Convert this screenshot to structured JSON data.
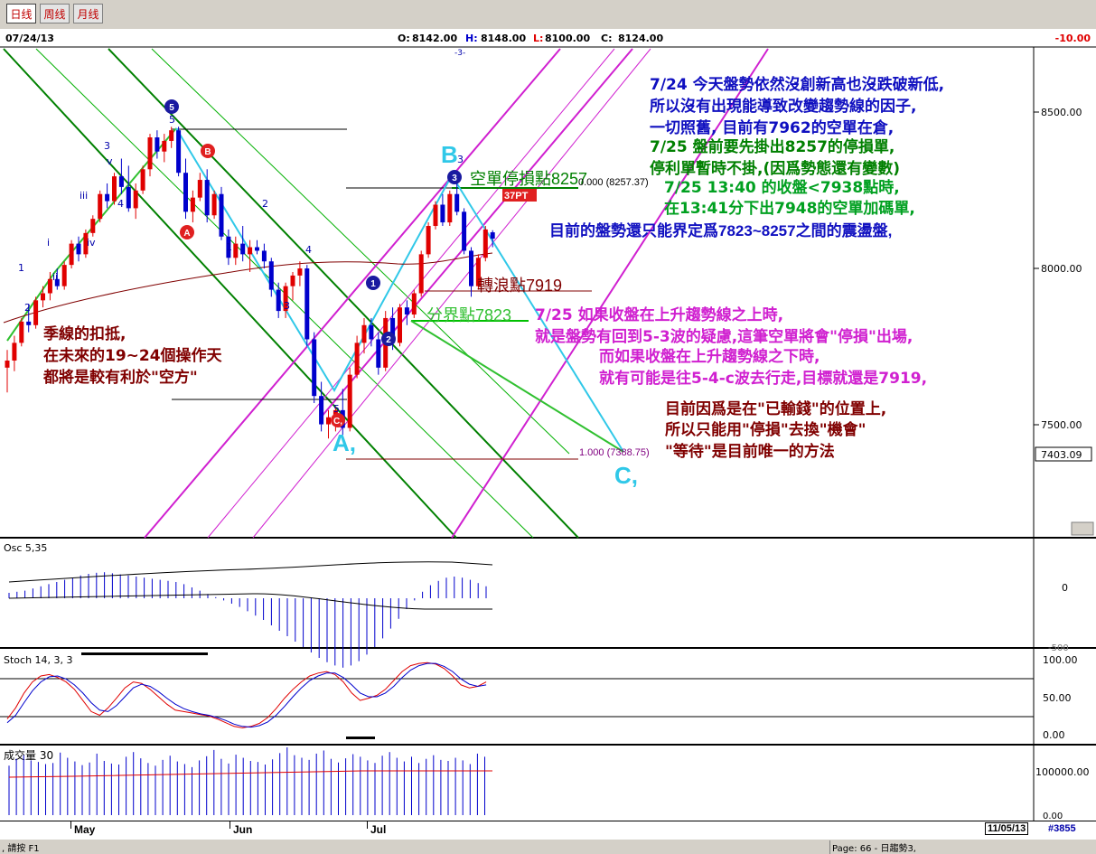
{
  "toolbar": {
    "buttons": [
      "日线",
      "周线",
      "月线"
    ]
  },
  "header": {
    "date": "07/24/13",
    "open_label": "O:",
    "open": "8142.00",
    "high_label": "H:",
    "high": "8148.00",
    "low_label": "L:",
    "low": "8100.00",
    "close_label": "C:",
    "close": "8124.00",
    "change": "-10.00"
  },
  "colors": {
    "up": "#e00000",
    "down": "#0000cc",
    "green_channel": "#008000",
    "magenta_channel": "#d020d0",
    "cyan_wave": "#30c8e8",
    "note_blue": "#1010c0",
    "note_green": "#008000",
    "note_magenta": "#d020d0",
    "note_maroon": "#800000"
  },
  "chart_data": [
    {
      "type": "candlestick",
      "title": "",
      "ylim": [
        7280,
        8660
      ],
      "y_ticks": [
        "8500.00",
        "8000.00",
        "7500.00"
      ],
      "last_price_label": "7403.09",
      "x_month_labels": [
        "May",
        "Jun",
        "Jul"
      ],
      "ohlc": [
        [
          7760,
          7810,
          7690,
          7780
        ],
        [
          7780,
          7850,
          7750,
          7830
        ],
        [
          7830,
          7900,
          7820,
          7890
        ],
        [
          7890,
          7940,
          7860,
          7880
        ],
        [
          7880,
          7960,
          7870,
          7950
        ],
        [
          7950,
          7990,
          7930,
          7970
        ],
        [
          7970,
          8030,
          7950,
          8010
        ],
        [
          8010,
          8040,
          7980,
          7990
        ],
        [
          7990,
          8060,
          7980,
          8050
        ],
        [
          8050,
          8120,
          8040,
          8110
        ],
        [
          8110,
          8130,
          8060,
          8080
        ],
        [
          8080,
          8150,
          8070,
          8140
        ],
        [
          8140,
          8190,
          8130,
          8180
        ],
        [
          8180,
          8260,
          8170,
          8250
        ],
        [
          8250,
          8280,
          8210,
          8230
        ],
        [
          8230,
          8310,
          8220,
          8300
        ],
        [
          8300,
          8350,
          8250,
          8270
        ],
        [
          8270,
          8330,
          8200,
          8210
        ],
        [
          8210,
          8280,
          8180,
          8260
        ],
        [
          8260,
          8330,
          8250,
          8320
        ],
        [
          8320,
          8420,
          8300,
          8410
        ],
        [
          8410,
          8430,
          8350,
          8370
        ],
        [
          8370,
          8420,
          8340,
          8400
        ],
        [
          8400,
          8440,
          8380,
          8430
        ],
        [
          8430,
          8440,
          8300,
          8310
        ],
        [
          8310,
          8350,
          8180,
          8200
        ],
        [
          8200,
          8260,
          8170,
          8240
        ],
        [
          8240,
          8310,
          8230,
          8290
        ],
        [
          8290,
          8320,
          8170,
          8190
        ],
        [
          8190,
          8260,
          8180,
          8250
        ],
        [
          8250,
          8270,
          8120,
          8130
        ],
        [
          8130,
          8150,
          8050,
          8070
        ],
        [
          8070,
          8130,
          8050,
          8110
        ],
        [
          8110,
          8160,
          8060,
          8080
        ],
        [
          8080,
          8120,
          8030,
          8100
        ],
        [
          8100,
          8120,
          8080,
          8090
        ],
        [
          8090,
          8110,
          8040,
          8060
        ],
        [
          8060,
          8070,
          7960,
          7980
        ],
        [
          7980,
          8000,
          7900,
          7920
        ],
        [
          7920,
          8000,
          7900,
          7990
        ],
        [
          7990,
          8030,
          7950,
          8020
        ],
        [
          8020,
          8060,
          7990,
          8040
        ],
        [
          8040,
          8050,
          7820,
          7840
        ],
        [
          7840,
          7860,
          7660,
          7680
        ],
        [
          7680,
          7720,
          7580,
          7600
        ],
        [
          7600,
          7640,
          7560,
          7620
        ],
        [
          7620,
          7650,
          7580,
          7640
        ],
        [
          7640,
          7700,
          7570,
          7590
        ],
        [
          7590,
          7760,
          7580,
          7740
        ],
        [
          7740,
          7850,
          7730,
          7830
        ],
        [
          7830,
          7900,
          7800,
          7880
        ],
        [
          7880,
          7900,
          7820,
          7840
        ],
        [
          7840,
          7860,
          7740,
          7760
        ],
        [
          7760,
          7920,
          7750,
          7900
        ],
        [
          7900,
          7930,
          7810,
          7830
        ],
        [
          7830,
          7940,
          7820,
          7930
        ],
        [
          7930,
          7950,
          7880,
          7910
        ],
        [
          7910,
          7980,
          7900,
          7970
        ],
        [
          7970,
          8090,
          7960,
          8080
        ],
        [
          8080,
          8170,
          8070,
          8160
        ],
        [
          8160,
          8230,
          8150,
          8220
        ],
        [
          8220,
          8250,
          8160,
          8170
        ],
        [
          8170,
          8260,
          8160,
          8250
        ],
        [
          8250,
          8280,
          8190,
          8200
        ],
        [
          8200,
          8210,
          8080,
          8090
        ],
        [
          8090,
          8100,
          7960,
          7990
        ],
        [
          7990,
          8080,
          7980,
          8070
        ],
        [
          8070,
          8160,
          8060,
          8150
        ],
        [
          8142,
          8148,
          8100,
          8124
        ]
      ]
    },
    {
      "type": "bar",
      "title": "Osc 5,35",
      "y_ticks": [
        "0",
        "-500"
      ],
      "values": [
        10,
        12,
        14,
        18,
        22,
        26,
        30,
        34,
        38,
        42,
        45,
        47,
        48,
        46,
        44,
        42,
        40,
        38,
        36,
        34,
        32,
        30,
        26,
        20,
        14,
        8,
        2,
        -4,
        -10,
        -16,
        -24,
        -32,
        -40,
        -50,
        -60,
        -70,
        -80,
        -90,
        -100,
        -110,
        -118,
        -124,
        -128,
        -124,
        -116,
        -104,
        -90,
        -74,
        -56,
        -38,
        -20,
        -4,
        12,
        24,
        32,
        38,
        40,
        38,
        34,
        28,
        22
      ]
    },
    {
      "type": "line",
      "title": "Stoch 14, 3, 3",
      "y_ticks": [
        "100.00",
        "50.00",
        "0.00"
      ],
      "series": [
        {
          "values": [
            20,
            35,
            55,
            70,
            78,
            80,
            76,
            70,
            60,
            45,
            30,
            25,
            35,
            48,
            62,
            70,
            68,
            60,
            50,
            40,
            32,
            30,
            28,
            26,
            24,
            20,
            15,
            10,
            8,
            10,
            14,
            22,
            34,
            48,
            60,
            70,
            78,
            82,
            84,
            80,
            70,
            55,
            45,
            48,
            52,
            60,
            72,
            84,
            92,
            95,
            96,
            94,
            88,
            78,
            66,
            62,
            64,
            70
          ]
        },
        {
          "values": [
            15,
            25,
            42,
            58,
            70,
            77,
            78,
            74,
            66,
            55,
            42,
            32,
            30,
            38,
            50,
            62,
            67,
            64,
            57,
            48,
            40,
            34,
            30,
            27,
            25,
            22,
            18,
            13,
            10,
            9,
            11,
            16,
            25,
            37,
            50,
            62,
            72,
            78,
            82,
            82,
            76,
            66,
            55,
            50,
            50,
            55,
            64,
            76,
            86,
            92,
            95,
            95,
            91,
            84,
            74,
            67,
            64,
            66
          ]
        }
      ]
    },
    {
      "type": "bar",
      "title": "成交量 30",
      "y_ticks": [
        "100000.00",
        "0.00"
      ],
      "values": [
        95000,
        108000,
        115000,
        105000,
        102000,
        98000,
        100000,
        120000,
        110000,
        103000,
        96000,
        101000,
        118000,
        104000,
        99000,
        97000,
        112000,
        121000,
        109000,
        100000,
        95000,
        106000,
        114000,
        103000,
        98000,
        92000,
        105000,
        113000,
        125000,
        108000,
        99000,
        116000,
        110000,
        104000,
        102000,
        97000,
        107000,
        119000,
        130000,
        115000,
        110000,
        106000,
        118000,
        124000,
        108000,
        101000,
        109000,
        117000,
        112000,
        105000,
        100000,
        114000,
        121000,
        110000,
        103000,
        112000,
        100000,
        108000,
        115000,
        106000,
        104000,
        110000,
        105000,
        98000,
        118000,
        112000
      ]
    }
  ],
  "annotations": {
    "wave_labels": [
      "B,",
      "A,",
      "C,",
      "B",
      "A",
      "5",
      "4",
      "3",
      "2",
      "1",
      "ii",
      "iii",
      "iv",
      "v",
      "i",
      "1",
      "2",
      "3",
      "4",
      "5"
    ],
    "stop_label": "空單停損點8257",
    "fib_top": "0.000 (8257.37)",
    "pt_tag": "37PT",
    "turn_label": "轉浪點7919",
    "boundary_label": "分界點7823",
    "fib_bottom": "1.000 (7388.75)",
    "left_note": [
      "季線的扣抵,",
      "在未來的19~24個操作天",
      "都將是較有利於\"空方\""
    ],
    "note_blue_lines": [
      "7/24 今天盤勢依然沒創新高也沒跌破新低,",
      "所以沒有出現能導致改變趨勢線的因子,",
      "一切照舊, 目前有7962的空單在倉,"
    ],
    "note_green_lines": [
      "7/25 盤前要先掛出8257的停損單,",
      "停利單暫時不掛,(因爲勢態還有變數)",
      "7/25  13:40 的收盤<7938點時,",
      "在13:41分下出7948的空單加碼單,"
    ],
    "note_blue_2": "目前的盤勢還只能界定爲7823~8257之間的震盪盤,",
    "note_magenta_lines": [
      "7/25 如果收盤在上升趨勢線之上時,",
      "就是盤勢有回到5-3波的疑慮,這筆空單將會\"停損\"出場,",
      "而如果收盤在上升趨勢線之下時,",
      "就有可能是往5-4-c波去行走,目標就還是7919,"
    ],
    "note_maroon_lines": [
      "目前因爲是在\"已輸錢\"的位置上,",
      "所以只能用\"停損\"去換\"機會\"",
      "\"等待\"是目前唯一的方法"
    ],
    "top_marker": "-3-"
  },
  "footer": {
    "date_box": "11/05/13",
    "record": "#3855",
    "status_left": ", 請按 F1",
    "status_right": "Page: 66 - 日趨勢3,"
  }
}
